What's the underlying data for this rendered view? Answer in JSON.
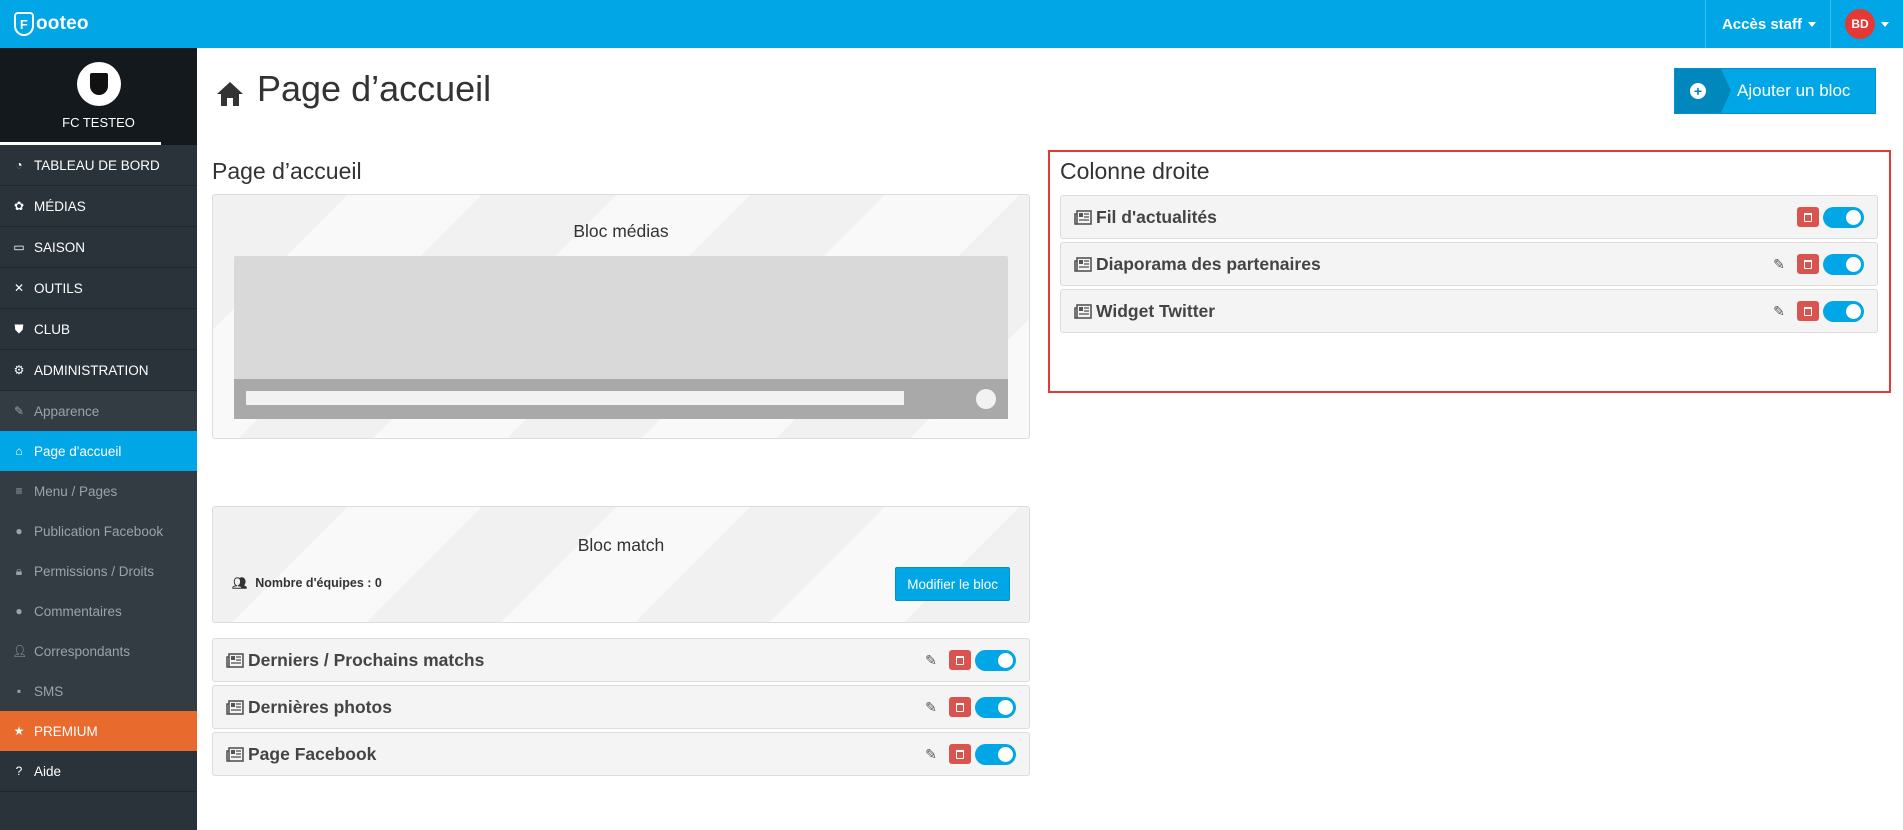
{
  "app": {
    "logo_text": "ooteo",
    "logo_mark": "F"
  },
  "topbar": {
    "staff_label": "Accès staff",
    "user_initials": "BD"
  },
  "club": {
    "name": "FC TESTEO"
  },
  "sidebar": {
    "items": [
      {
        "label": "TABLEAU DE BORD",
        "icon": "dashboard-icon"
      },
      {
        "label": "MÉDIAS",
        "icon": "palette-icon"
      },
      {
        "label": "SAISON",
        "icon": "card-icon"
      },
      {
        "label": "OUTILS",
        "icon": "tools-icon"
      },
      {
        "label": "CLUB",
        "icon": "shield-icon"
      },
      {
        "label": "ADMINISTRATION",
        "icon": "gear-icon"
      }
    ],
    "subitems": [
      {
        "label": "Apparence",
        "icon": "pencil-icon"
      },
      {
        "label": "Page d'accueil",
        "icon": "home-icon",
        "active": true
      },
      {
        "label": "Menu / Pages",
        "icon": "menu-icon"
      },
      {
        "label": "Publication Facebook",
        "icon": "facebook-icon"
      },
      {
        "label": "Permissions / Droits",
        "icon": "lock-icon"
      },
      {
        "label": "Commentaires",
        "icon": "comment-icon"
      },
      {
        "label": "Correspondants",
        "icon": "user-plus-icon"
      },
      {
        "label": "SMS",
        "icon": "sms-icon"
      }
    ],
    "premium": {
      "label": "PREMIUM",
      "icon": "star-icon"
    },
    "help": {
      "label": "Aide",
      "icon": "question-icon"
    }
  },
  "main": {
    "title": "Page d’accueil",
    "add_button": "Ajouter un bloc",
    "left_column": {
      "title": "Page d’accueil",
      "media_block": {
        "title": "Bloc médias"
      },
      "match_block": {
        "title": "Bloc match",
        "teams_label": "Nombre d'équipes : 0",
        "modify_button": "Modifier le bloc"
      },
      "rows": [
        {
          "label": "Derniers / Prochains matchs",
          "editable": true,
          "enabled": true
        },
        {
          "label": "Dernières photos",
          "editable": true,
          "enabled": true
        },
        {
          "label": "Page Facebook",
          "editable": true,
          "enabled": true
        }
      ]
    },
    "right_column": {
      "title": "Colonne droite",
      "rows": [
        {
          "label": "Fil d'actualités",
          "editable": false,
          "enabled": true
        },
        {
          "label": "Diaporama des partenaires",
          "editable": true,
          "enabled": true
        },
        {
          "label": "Widget Twitter",
          "editable": true,
          "enabled": true
        }
      ]
    }
  },
  "colors": {
    "primary": "#00a6e5",
    "sidebar": "#2b333a",
    "premium": "#e86a2c",
    "danger": "#d9534f",
    "highlight": "#e53935"
  }
}
